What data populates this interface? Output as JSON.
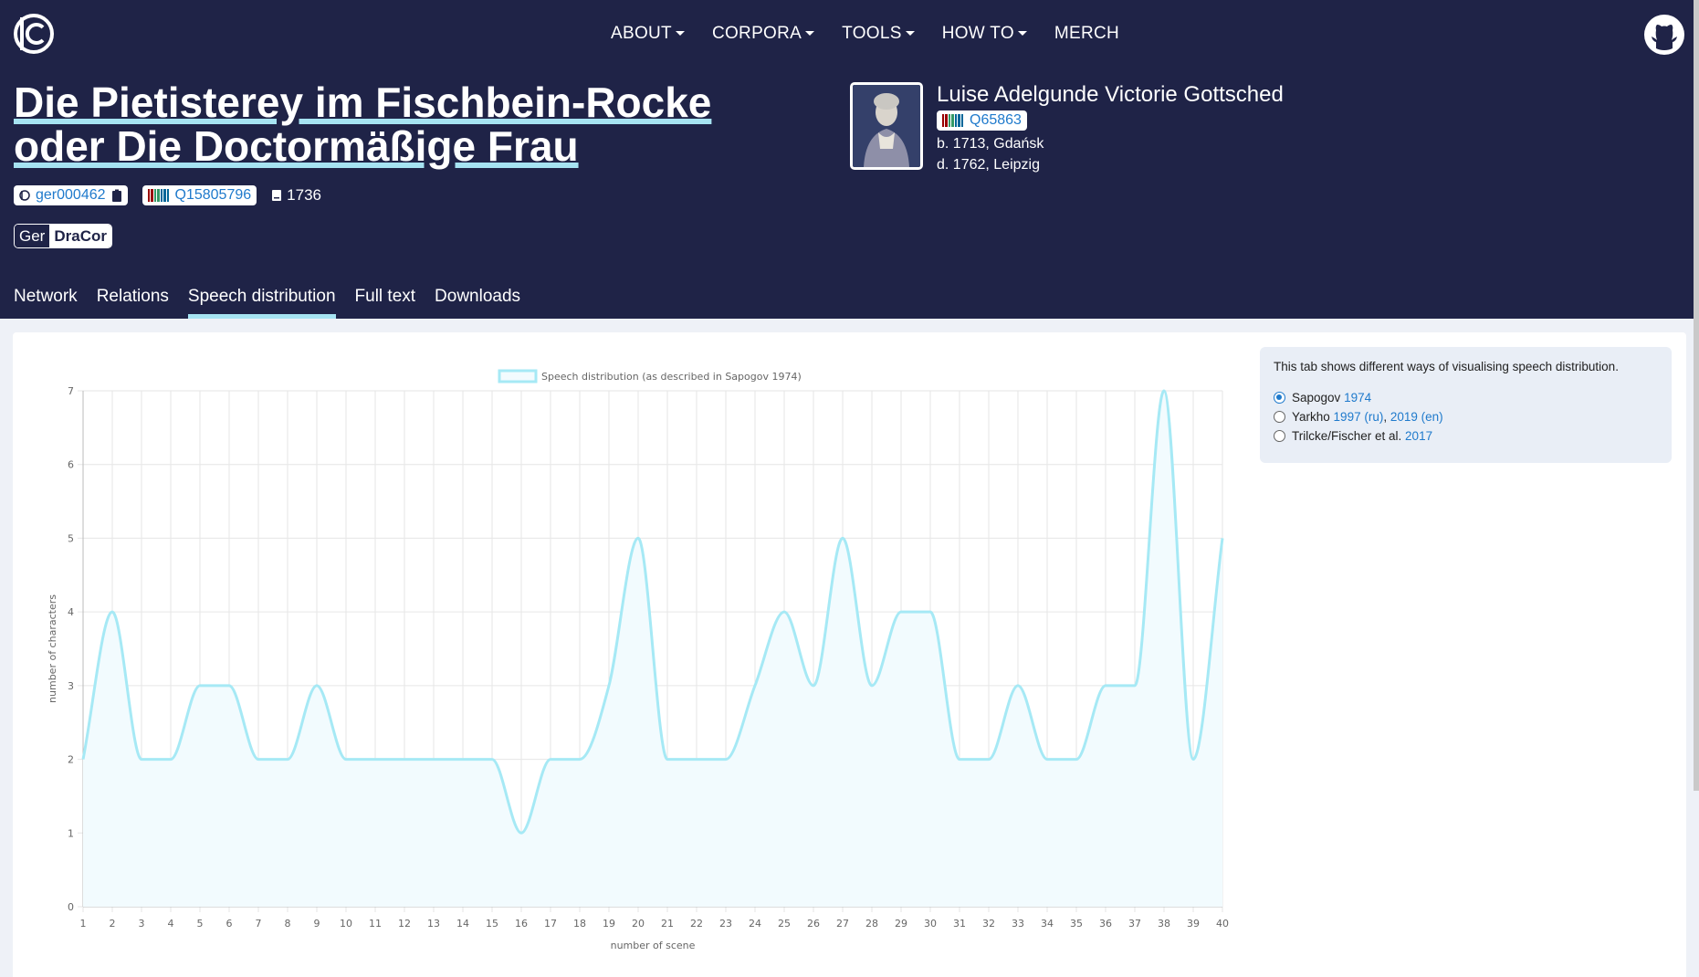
{
  "nav": {
    "logo": "dracor-logo",
    "items": [
      {
        "label": "ABOUT",
        "dropdown": true
      },
      {
        "label": "CORPORA",
        "dropdown": true
      },
      {
        "label": "TOOLS",
        "dropdown": true
      },
      {
        "label": "HOW TO",
        "dropdown": true
      },
      {
        "label": "MERCH",
        "dropdown": false
      }
    ],
    "github_icon": "github-icon"
  },
  "play": {
    "title": "Die Pietisterey im Fischbein-Rocke oder Die Doctormäßige Frau",
    "id": "ger000462",
    "wikidata": "Q15805796",
    "year": "1736",
    "corpus_prefix": "Ger",
    "corpus_name": "DraCor"
  },
  "author": {
    "name": "Luise Adelgunde Victorie Gottsched",
    "wikidata": "Q65863",
    "birth": "b. 1713, Gdańsk",
    "death": "d. 1762, Leipzig"
  },
  "tabs": [
    {
      "label": "Network",
      "active": false
    },
    {
      "label": "Relations",
      "active": false
    },
    {
      "label": "Speech distribution",
      "active": true
    },
    {
      "label": "Full text",
      "active": false
    },
    {
      "label": "Downloads",
      "active": false
    }
  ],
  "info": {
    "description": "This tab shows different ways of visualising speech distribution.",
    "options": [
      {
        "label": "Sapogov",
        "links": [
          "1974"
        ],
        "selected": true
      },
      {
        "label": "Yarkho",
        "links": [
          "1997 (ru)",
          "2019 (en)"
        ],
        "selected": false
      },
      {
        "label": "Trilcke/Fischer et al.",
        "links": [
          "2017"
        ],
        "selected": false
      }
    ]
  },
  "colors": {
    "header_bg": "#1f2347",
    "accent": "#a6e3f2",
    "link": "#1f7acc"
  },
  "chart_data": {
    "type": "line",
    "legend": "Speech distribution (as described in Sapogov 1974)",
    "legend_position": "top-center",
    "xlabel": "number of scene",
    "ylabel": "number of characters",
    "x": [
      1,
      2,
      3,
      4,
      5,
      6,
      7,
      8,
      9,
      10,
      11,
      12,
      13,
      14,
      15,
      16,
      17,
      18,
      19,
      20,
      21,
      22,
      23,
      24,
      25,
      26,
      27,
      28,
      29,
      30,
      31,
      32,
      33,
      34,
      35,
      36,
      37,
      38,
      39,
      40
    ],
    "values": [
      2,
      4,
      2,
      2,
      3,
      3,
      2,
      2,
      3,
      2,
      2,
      2,
      2,
      2,
      2,
      1,
      2,
      2,
      3,
      5,
      2,
      2,
      2,
      3,
      4,
      3,
      5,
      3,
      4,
      4,
      2,
      2,
      3,
      2,
      2,
      3,
      3,
      7,
      2,
      5
    ],
    "ylim": [
      0,
      7
    ],
    "yticks": [
      0,
      1,
      2,
      3,
      4,
      5,
      6,
      7
    ],
    "grid": true,
    "series_color": "#a6e9f5"
  }
}
